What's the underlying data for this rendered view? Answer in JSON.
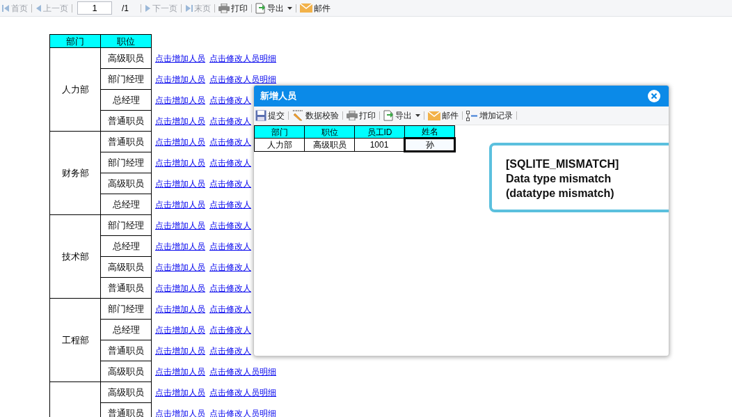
{
  "toolbar": {
    "items": [
      {
        "kind": "first",
        "label": "首页",
        "disabled": true
      },
      {
        "kind": "prev",
        "label": "上一页",
        "disabled": true
      },
      {
        "kind": "page",
        "value": "1",
        "total": "/1"
      },
      {
        "kind": "next",
        "label": "下一页",
        "disabled": true
      },
      {
        "kind": "last",
        "label": "末页",
        "disabled": true
      },
      {
        "kind": "print",
        "label": "打印",
        "disabled": false
      },
      {
        "kind": "export",
        "label": "导出",
        "disabled": false
      },
      {
        "kind": "mail",
        "label": "邮件",
        "disabled": false
      }
    ]
  },
  "report": {
    "columns": [
      "部门",
      "职位"
    ],
    "groups": [
      {
        "department": "人力部",
        "rows": [
          {
            "position": "高级职员",
            "links": [
              "点击增加人员",
              "点击修改人员明细"
            ]
          },
          {
            "position": "部门经理",
            "links": [
              "点击增加人员",
              "点击修改人员明细"
            ]
          },
          {
            "position": "总经理",
            "links": [
              "点击增加人员",
              "点击修改人"
            ]
          },
          {
            "position": "普通职员",
            "links": [
              "点击增加人员",
              "点击修改人"
            ]
          }
        ]
      },
      {
        "department": "财务部",
        "rows": [
          {
            "position": "普通职员",
            "links": [
              "点击增加人员",
              "点击修改人"
            ]
          },
          {
            "position": "部门经理",
            "links": [
              "点击增加人员",
              "点击修改人"
            ]
          },
          {
            "position": "高级职员",
            "links": [
              "点击增加人员",
              "点击修改人"
            ]
          },
          {
            "position": "总经理",
            "links": [
              "点击增加人员",
              "点击修改人"
            ]
          }
        ]
      },
      {
        "department": "技术部",
        "rows": [
          {
            "position": "部门经理",
            "links": [
              "点击增加人员",
              "点击修改人"
            ]
          },
          {
            "position": "总经理",
            "links": [
              "点击增加人员",
              "点击修改人"
            ]
          },
          {
            "position": "高级职员",
            "links": [
              "点击增加人员",
              "点击修改人"
            ]
          },
          {
            "position": "普通职员",
            "links": [
              "点击增加人员",
              "点击修改人"
            ]
          }
        ]
      },
      {
        "department": "工程部",
        "rows": [
          {
            "position": "部门经理",
            "links": [
              "点击增加人员",
              "点击修改人"
            ]
          },
          {
            "position": "总经理",
            "links": [
              "点击增加人员",
              "点击修改人"
            ]
          },
          {
            "position": "普通职员",
            "links": [
              "点击增加人员",
              "点击修改人"
            ]
          },
          {
            "position": "高级职员",
            "links": [
              "点击增加人员",
              "点击修改人员明细"
            ]
          }
        ]
      },
      {
        "rows": [
          {
            "position": "高级职员",
            "links": [
              "点击增加人员",
              "点击修改人员明细"
            ]
          },
          {
            "position": "普通职员",
            "links": [
              "点击增加人员",
              "点击修改人员明细"
            ]
          }
        ]
      }
    ]
  },
  "dialog": {
    "title": "新增人员",
    "toolbar": [
      {
        "kind": "submit",
        "label": "提交"
      },
      {
        "kind": "validate",
        "label": "数据校验"
      },
      {
        "kind": "print",
        "label": "打印"
      },
      {
        "kind": "export",
        "label": "导出"
      },
      {
        "kind": "mail",
        "label": "邮件"
      },
      {
        "kind": "add_record",
        "label": "增加记录"
      }
    ],
    "table": {
      "columns": [
        "部门",
        "职位",
        "员工ID",
        "姓名"
      ],
      "rows": [
        [
          {
            "text": "人力部",
            "selected": false
          },
          {
            "text": "高级职员",
            "selected": false
          },
          {
            "text": "1001",
            "selected": false
          },
          {
            "text": "孙",
            "selected": true
          }
        ]
      ]
    },
    "error": {
      "lines": [
        "[SQLITE_MISMATCH]",
        "Data type mismatch",
        "(datatype mismatch)"
      ]
    }
  }
}
